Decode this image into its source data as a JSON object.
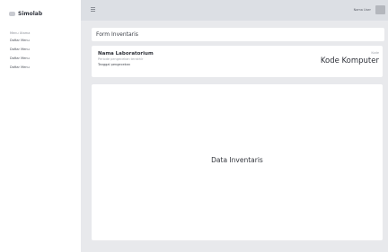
{
  "sidebar": {
    "brand": "Simolab",
    "items": [
      {
        "label": "Menu Utama"
      },
      {
        "label": "Daftar Menu"
      },
      {
        "label": "Daftar Menu"
      },
      {
        "label": "Daftar Menu"
      },
      {
        "label": "Daftar Menu"
      }
    ]
  },
  "topbar": {
    "user_name": "Nama User"
  },
  "main": {
    "section_title": "Form Inventaris",
    "info": {
      "lab_name": "Nama Laboratorium",
      "lab_subtitle": "Periode pengecekan terakhir",
      "date_label": "Tanggal pengecekan",
      "code_label": "Kode",
      "code_value": "Kode Komputer"
    },
    "data_title": "Data Inventaris"
  }
}
